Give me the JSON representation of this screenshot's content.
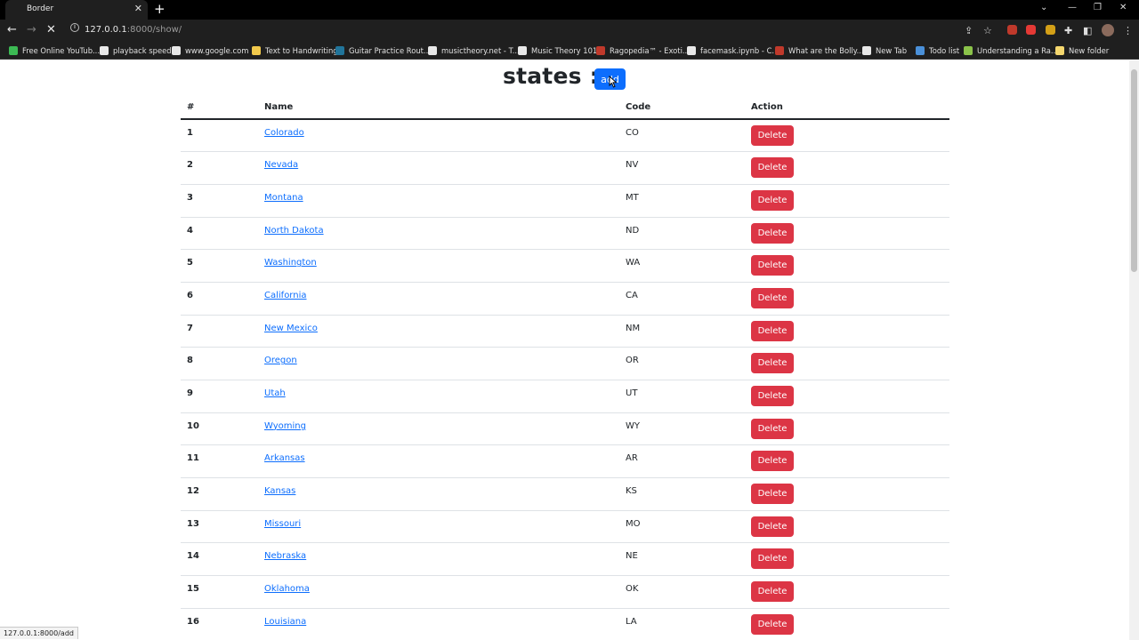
{
  "browser": {
    "tab_title": "Border",
    "tab_close": "✕",
    "new_tab": "+",
    "url_host": "127.0.0.1",
    "url_path": ":8000/show/",
    "status_url": "127.0.0.1:8000/add",
    "bookmarks": [
      {
        "label": "Free Online YouTub...",
        "color": "#3cba54"
      },
      {
        "label": "playback speed",
        "color": "#e8e8e8"
      },
      {
        "label": "www.google.com",
        "color": "#e8e8e8"
      },
      {
        "label": "Text to Handwriting",
        "color": "#f2c94c"
      },
      {
        "label": "Guitar Practice Rout...",
        "color": "#21759b"
      },
      {
        "label": "musictheory.net - T...",
        "color": "#e8e8e8"
      },
      {
        "label": "Music Theory 101",
        "color": "#e8e8e8"
      },
      {
        "label": "Ragopedia™ - Exoti...",
        "color": "#c0392b"
      },
      {
        "label": "facemask.ipynb - C...",
        "color": "#e8e8e8"
      },
      {
        "label": "What are the Bolly...",
        "color": "#c0392b"
      },
      {
        "label": "New Tab",
        "color": "#e8e8e8"
      },
      {
        "label": "Todo list",
        "color": "#4a90d9"
      },
      {
        "label": "Understanding a Ra...",
        "color": "#8bc34a"
      },
      {
        "label": "New folder",
        "color": "#f5d76e"
      }
    ]
  },
  "page": {
    "heading": "states :-",
    "add_button": "add",
    "columns": {
      "num": "#",
      "name": "Name",
      "code": "Code",
      "action": "Action"
    },
    "delete_label": "Delete",
    "rows": [
      {
        "num": "1",
        "name": "Colorado",
        "code": "CO"
      },
      {
        "num": "2",
        "name": "Nevada",
        "code": "NV"
      },
      {
        "num": "3",
        "name": "Montana",
        "code": "MT"
      },
      {
        "num": "4",
        "name": "North Dakota",
        "code": "ND"
      },
      {
        "num": "5",
        "name": "Washington",
        "code": "WA"
      },
      {
        "num": "6",
        "name": "California",
        "code": "CA"
      },
      {
        "num": "7",
        "name": "New Mexico",
        "code": "NM"
      },
      {
        "num": "8",
        "name": "Oregon",
        "code": "OR"
      },
      {
        "num": "9",
        "name": "Utah",
        "code": "UT"
      },
      {
        "num": "10",
        "name": "Wyoming",
        "code": "WY"
      },
      {
        "num": "11",
        "name": "Arkansas",
        "code": "AR"
      },
      {
        "num": "12",
        "name": "Kansas",
        "code": "KS"
      },
      {
        "num": "13",
        "name": "Missouri",
        "code": "MO"
      },
      {
        "num": "14",
        "name": "Nebraska",
        "code": "NE"
      },
      {
        "num": "15",
        "name": "Oklahoma",
        "code": "OK"
      },
      {
        "num": "16",
        "name": "Louisiana",
        "code": "LA"
      }
    ]
  }
}
